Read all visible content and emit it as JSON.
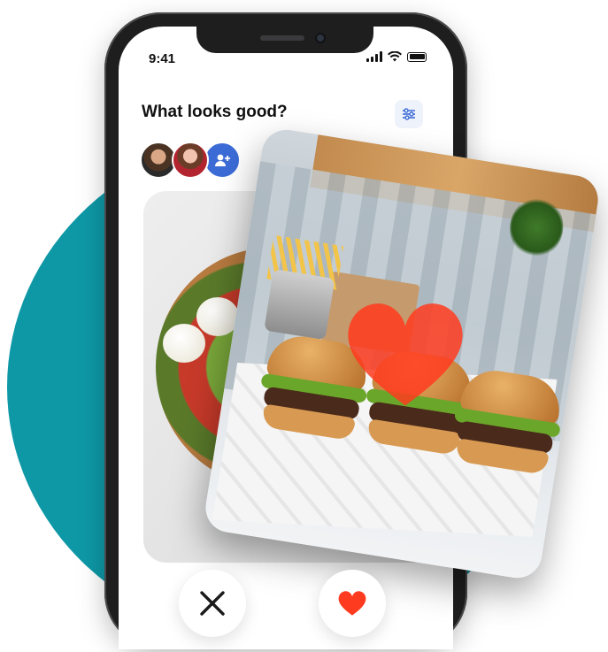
{
  "status_bar": {
    "time": "9:41"
  },
  "header": {
    "title": "What looks good?"
  },
  "icons": {
    "filter": "sliders-icon",
    "add_friend": "add-person-icon",
    "dislike": "close-x-icon",
    "like": "heart-icon",
    "overlay": "heart-icon"
  },
  "colors": {
    "teal": "#0e98a6",
    "accent_blue": "#3c6bd6",
    "heart_red": "#ff3b1f"
  }
}
